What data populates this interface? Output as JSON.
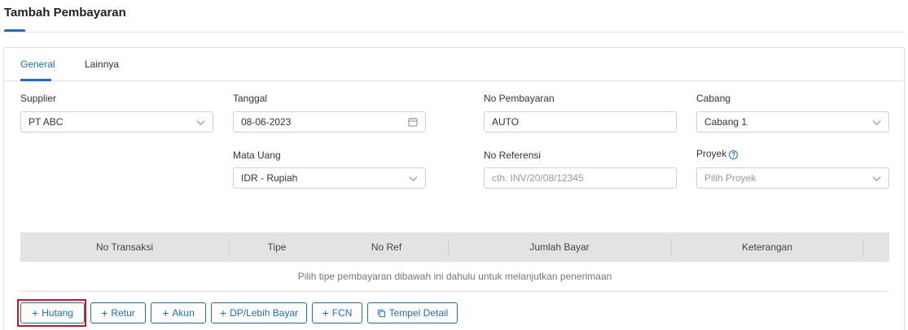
{
  "page": {
    "title": "Tambah Pembayaran"
  },
  "tabs": [
    {
      "label": "General",
      "active": true
    },
    {
      "label": "Lainnya",
      "active": false
    }
  ],
  "form": {
    "supplier": {
      "label": "Supplier",
      "value": "PT ABC",
      "icon": "chevron-down-icon"
    },
    "tanggal": {
      "label": "Tanggal",
      "value": "08-06-2023",
      "icon": "calendar-icon"
    },
    "no_pembayaran": {
      "label": "No Pembayaran",
      "value": "AUTO"
    },
    "cabang": {
      "label": "Cabang",
      "value": "Cabang 1",
      "icon": "chevron-down-icon"
    },
    "mata_uang": {
      "label": "Mata Uang",
      "value": "IDR - Rupiah",
      "icon": "chevron-down-icon"
    },
    "no_referensi": {
      "label": "No Referensi",
      "value": "",
      "placeholder": "cth. INV/20/08/12345"
    },
    "proyek": {
      "label": "Proyek",
      "value": "",
      "placeholder": "Pilih Proyek",
      "help_icon": "question-circle-icon"
    }
  },
  "table": {
    "columns": [
      "No Transaksi",
      "Tipe",
      "No Ref",
      "Jumlah Bayar",
      "Keterangan"
    ],
    "empty_message": "Pilih tipe pembayaran dibawah ini dahulu untuk melanjutkan penerimaan"
  },
  "actions": [
    {
      "label": "Hutang",
      "icon": "plus-icon",
      "highlighted": true
    },
    {
      "label": "Retur",
      "icon": "plus-icon"
    },
    {
      "label": "Akun",
      "icon": "plus-icon"
    },
    {
      "label": "DP/Lebih Bayar",
      "icon": "plus-icon"
    },
    {
      "label": "FCN",
      "icon": "plus-icon"
    },
    {
      "label": "Tempel Detail",
      "icon": "copy-icon"
    }
  ],
  "colors": {
    "accent": "#1a6fc4",
    "highlight": "#d0161b",
    "table_header": "#e3e3e3"
  }
}
